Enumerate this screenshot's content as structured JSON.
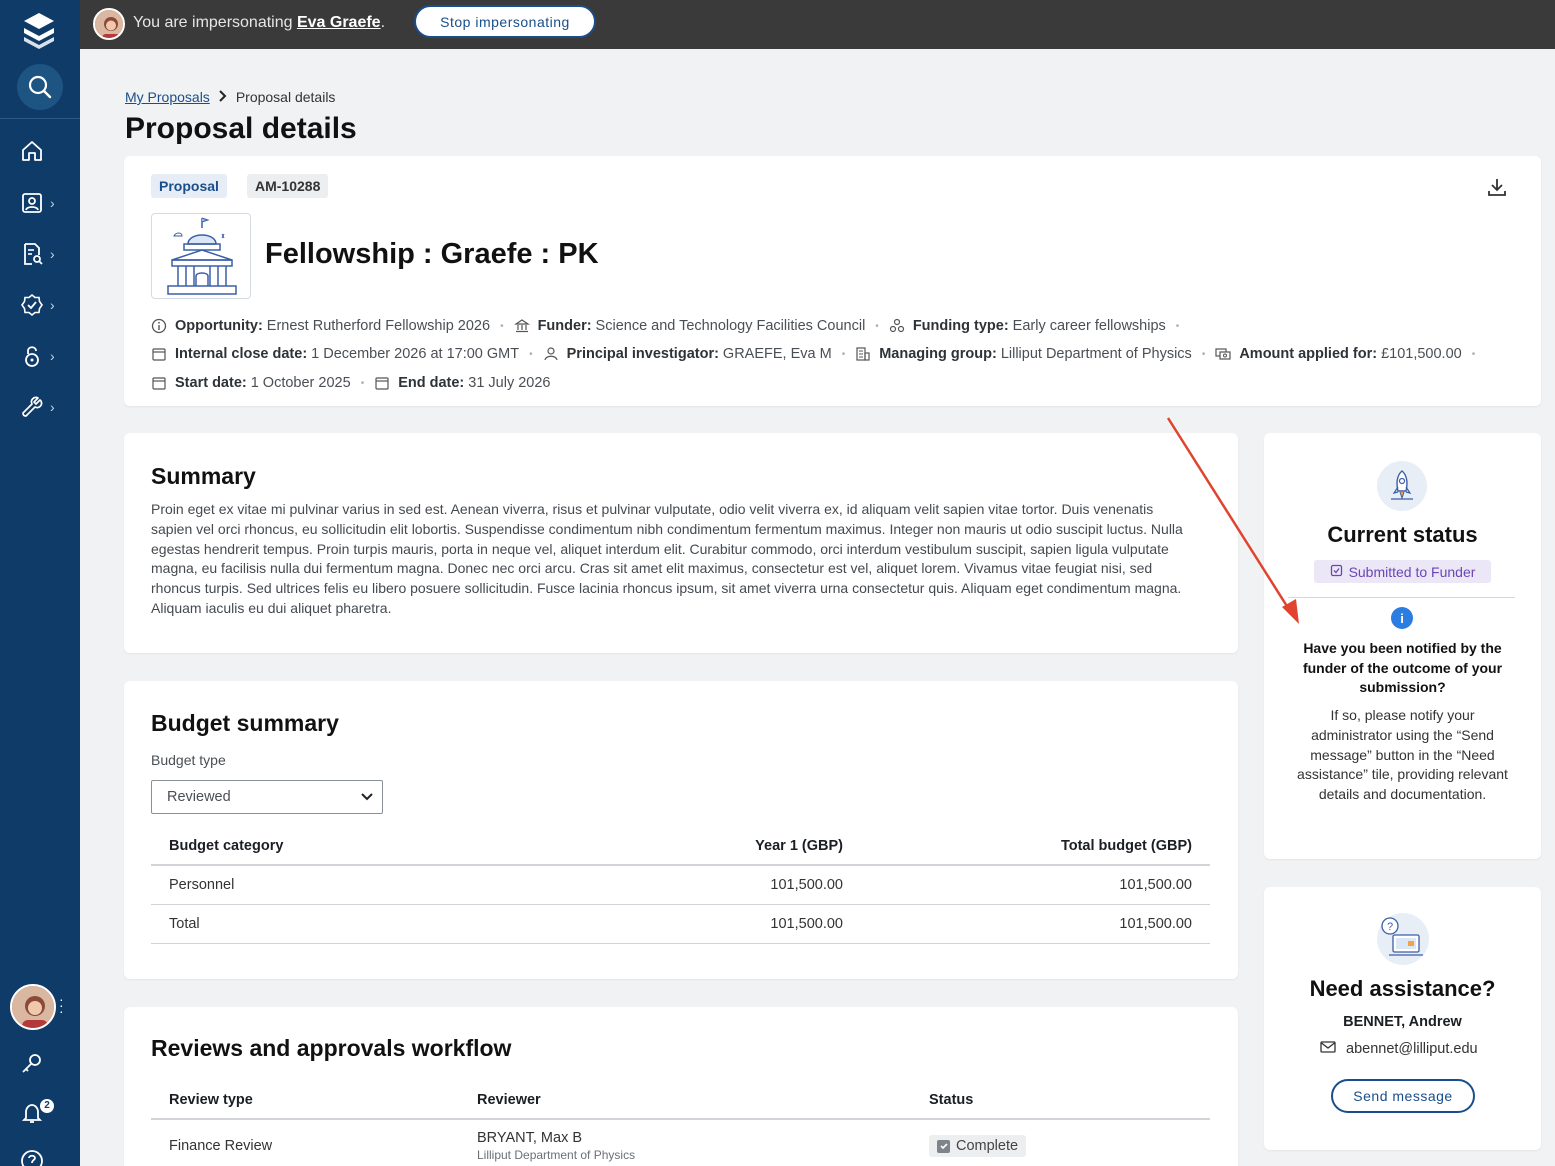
{
  "topbar": {
    "impersonating_prefix": "You are impersonating",
    "impersonated_user": "Eva Graefe",
    "impersonating_suffix": ".",
    "stop_button": "Stop impersonating"
  },
  "sidebar": {
    "items": [
      {
        "icon": "home-icon"
      },
      {
        "icon": "person-card-icon"
      },
      {
        "icon": "document-search-icon"
      },
      {
        "icon": "badge-check-icon"
      },
      {
        "icon": "lock-icon"
      },
      {
        "icon": "wrench-icon"
      }
    ],
    "notification_count": "2"
  },
  "breadcrumb": {
    "parent": "My Proposals",
    "current": "Proposal details"
  },
  "page_title": "Proposal details",
  "proposal": {
    "type_chip": "Proposal",
    "id_chip": "AM-10288",
    "title": "Fellowship : Graefe : PK",
    "meta": {
      "opportunity_label": "Opportunity:",
      "opportunity": "Ernest Rutherford Fellowship 2026",
      "funder_label": "Funder:",
      "funder": "Science and Technology Facilities Council",
      "funding_type_label": "Funding type:",
      "funding_type": "Early career fellowships",
      "internal_close_label": "Internal close date:",
      "internal_close": "1 December 2026 at 17:00 GMT",
      "pi_label": "Principal investigator:",
      "pi": "GRAEFE, Eva M",
      "managing_group_label": "Managing group:",
      "managing_group": "Lilliput Department of Physics",
      "amount_label": "Amount applied for:",
      "amount": "£101,500.00",
      "start_label": "Start date:",
      "start": "1 October 2025",
      "end_label": "End date:",
      "end": "31 July 2026"
    }
  },
  "summary": {
    "title": "Summary",
    "text": "Proin eget ex vitae mi pulvinar varius in sed est. Aenean viverra, risus et pulvinar vulputate, odio velit viverra ex, id aliquam velit sapien vitae tortor. Duis venenatis sapien vel orci rhoncus, eu sollicitudin elit lobortis. Suspendisse condimentum nibh condimentum fermentum maximus. Integer non mauris ut odio suscipit luctus. Nulla egestas hendrerit tempus. Proin turpis mauris, porta in neque vel, aliquet interdum elit. Curabitur commodo, orci interdum vestibulum suscipit, sapien ligula vulputate magna, eu facilisis nulla dui fermentum magna. Donec nec orci arcu. Cras sit amet elit maximus, consectetur est vel, aliquet lorem. Vivamus vitae feugiat nisi, sed rhoncus turpis. Sed ultrices felis eu libero posuere sollicitudin. Fusce lacinia rhoncus ipsum, sit amet viverra urna consectetur quis. Aliquam eget condimentum magna. Aliquam iaculis eu dui aliquet pharetra."
  },
  "budget": {
    "title": "Budget summary",
    "type_label": "Budget type",
    "type_value": "Reviewed",
    "columns": [
      "Budget category",
      "Year 1 (GBP)",
      "Total budget (GBP)"
    ],
    "rows": [
      [
        "Personnel",
        "101,500.00",
        "101,500.00"
      ],
      [
        "Total",
        "101,500.00",
        "101,500.00"
      ]
    ]
  },
  "workflow": {
    "title": "Reviews and approvals workflow",
    "columns": [
      "Review type",
      "Reviewer",
      "Status"
    ],
    "rows": [
      {
        "type": "Finance Review",
        "reviewer": "BRYANT, Max B",
        "reviewer_group": "Lilliput Department of Physics",
        "status": "Complete"
      }
    ]
  },
  "status_card": {
    "title": "Current status",
    "badge": "Submitted to Funder",
    "question": "Have you been notified by the funder of the outcome of your submission?",
    "help": "If so, please notify your administrator using the “Send message” button in the “Need assistance” tile, providing relevant details and documentation."
  },
  "assist_card": {
    "title": "Need assistance?",
    "name": "BENNET, Andrew",
    "email": "abennet@lilliput.edu",
    "send_button": "Send message"
  },
  "colors": {
    "sidebar": "#0f3b68",
    "topbar": "#3a3a3a",
    "accent": "#1a4e8a",
    "status_purple": "#6b45b8",
    "annotation_arrow": "#e0442e"
  }
}
